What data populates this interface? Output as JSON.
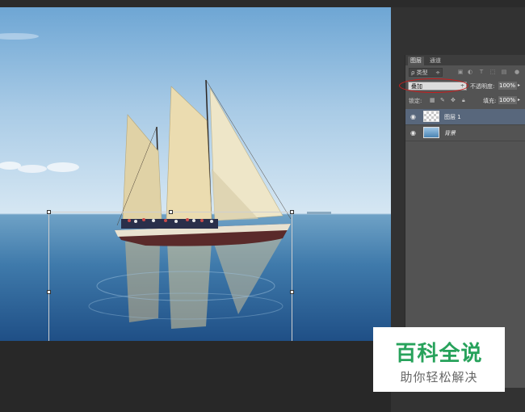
{
  "layers_panel": {
    "tabs": [
      "图层",
      "通道"
    ],
    "filter": {
      "kind_label": "ρ 类型",
      "kind_arrow": "÷"
    },
    "blend": {
      "mode": "叠加",
      "arrow": "÷",
      "opacity_label": "不透明度:",
      "opacity_value": "100%",
      "dropdown_arrow": "▸"
    },
    "lock": {
      "label": "锁定:",
      "fill_label": "填充:",
      "fill_value": "100%",
      "dropdown_arrow": "▸"
    },
    "layers": [
      {
        "name": "图层 1",
        "selected": true,
        "thumbnail": "transparent-checker"
      },
      {
        "name": "背景",
        "selected": false,
        "thumbnail": "photo"
      }
    ]
  },
  "watermark": {
    "title": "百科全说",
    "subtitle": "助你轻松解决",
    "color": "#27a25b"
  },
  "colors": {
    "workspace": "#282828",
    "panel": "#535353",
    "selected_layer": "#58677c",
    "annotation": "#c81e1e"
  }
}
